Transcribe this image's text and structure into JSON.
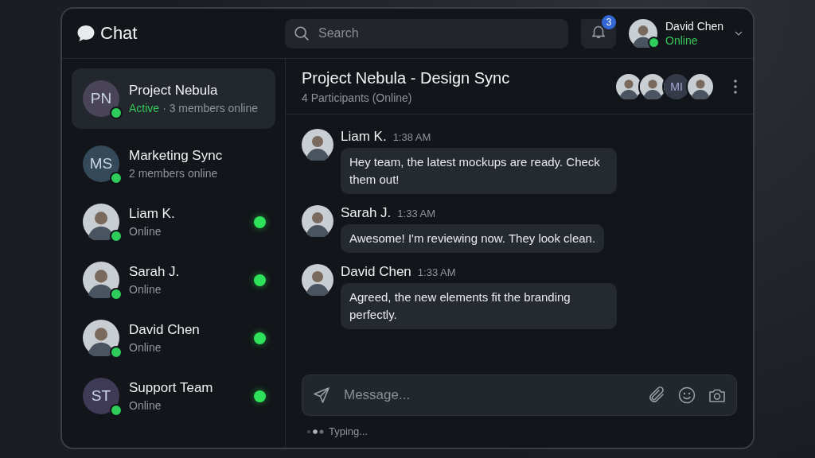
{
  "app": {
    "title": "Chat"
  },
  "search": {
    "placeholder": "Search"
  },
  "notifications": {
    "count": "3"
  },
  "user": {
    "name": "David Chen",
    "status": "Online",
    "online": true
  },
  "conversations": [
    {
      "name": "Project Nebula",
      "avatar": {
        "kind": "initials",
        "text": "PN",
        "color": "#4a4458"
      },
      "status": "Active",
      "subtitle": "· 3 members online",
      "online": true,
      "indicator": false,
      "selected": true
    },
    {
      "name": "Marketing Sync",
      "avatar": {
        "kind": "initials",
        "text": "MS",
        "color": "#34495a"
      },
      "subtitle": "2 members online",
      "online": true,
      "indicator": false,
      "selected": false
    },
    {
      "name": "Liam K.",
      "avatar": {
        "kind": "person"
      },
      "subtitle": "Online",
      "online": true,
      "indicator": true,
      "selected": false
    },
    {
      "name": "Sarah J.",
      "avatar": {
        "kind": "person"
      },
      "subtitle": "Online",
      "online": true,
      "indicator": true,
      "selected": false
    },
    {
      "name": "David Chen",
      "avatar": {
        "kind": "person"
      },
      "subtitle": "Online",
      "online": true,
      "indicator": true,
      "selected": false
    },
    {
      "name": "Support Team",
      "avatar": {
        "kind": "initials",
        "text": "ST",
        "color": "#3f3a55"
      },
      "subtitle": "Online",
      "online": true,
      "indicator": true,
      "selected": false
    }
  ],
  "chat": {
    "title": "Project Nebula - Design Sync",
    "subtitle": "4 Participants (Online)",
    "participants": [
      {
        "kind": "person"
      },
      {
        "kind": "person"
      },
      {
        "kind": "initials",
        "text": "MI",
        "color": "#343a48"
      },
      {
        "kind": "person"
      }
    ]
  },
  "messages": [
    {
      "author": "Liam K.",
      "time": "1:38 AM",
      "text": "Hey team, the latest mockups are ready. Check them out!"
    },
    {
      "author": "Sarah J.",
      "time": "1:33 AM",
      "text": "Awesome! I'm reviewing now. They look clean."
    },
    {
      "author": "David Chen",
      "time": "1:33 AM",
      "text": "Agreed, the new elements fit the branding perfectly."
    }
  ],
  "composer": {
    "placeholder": "Message..."
  },
  "typing": {
    "text": "Typing..."
  }
}
